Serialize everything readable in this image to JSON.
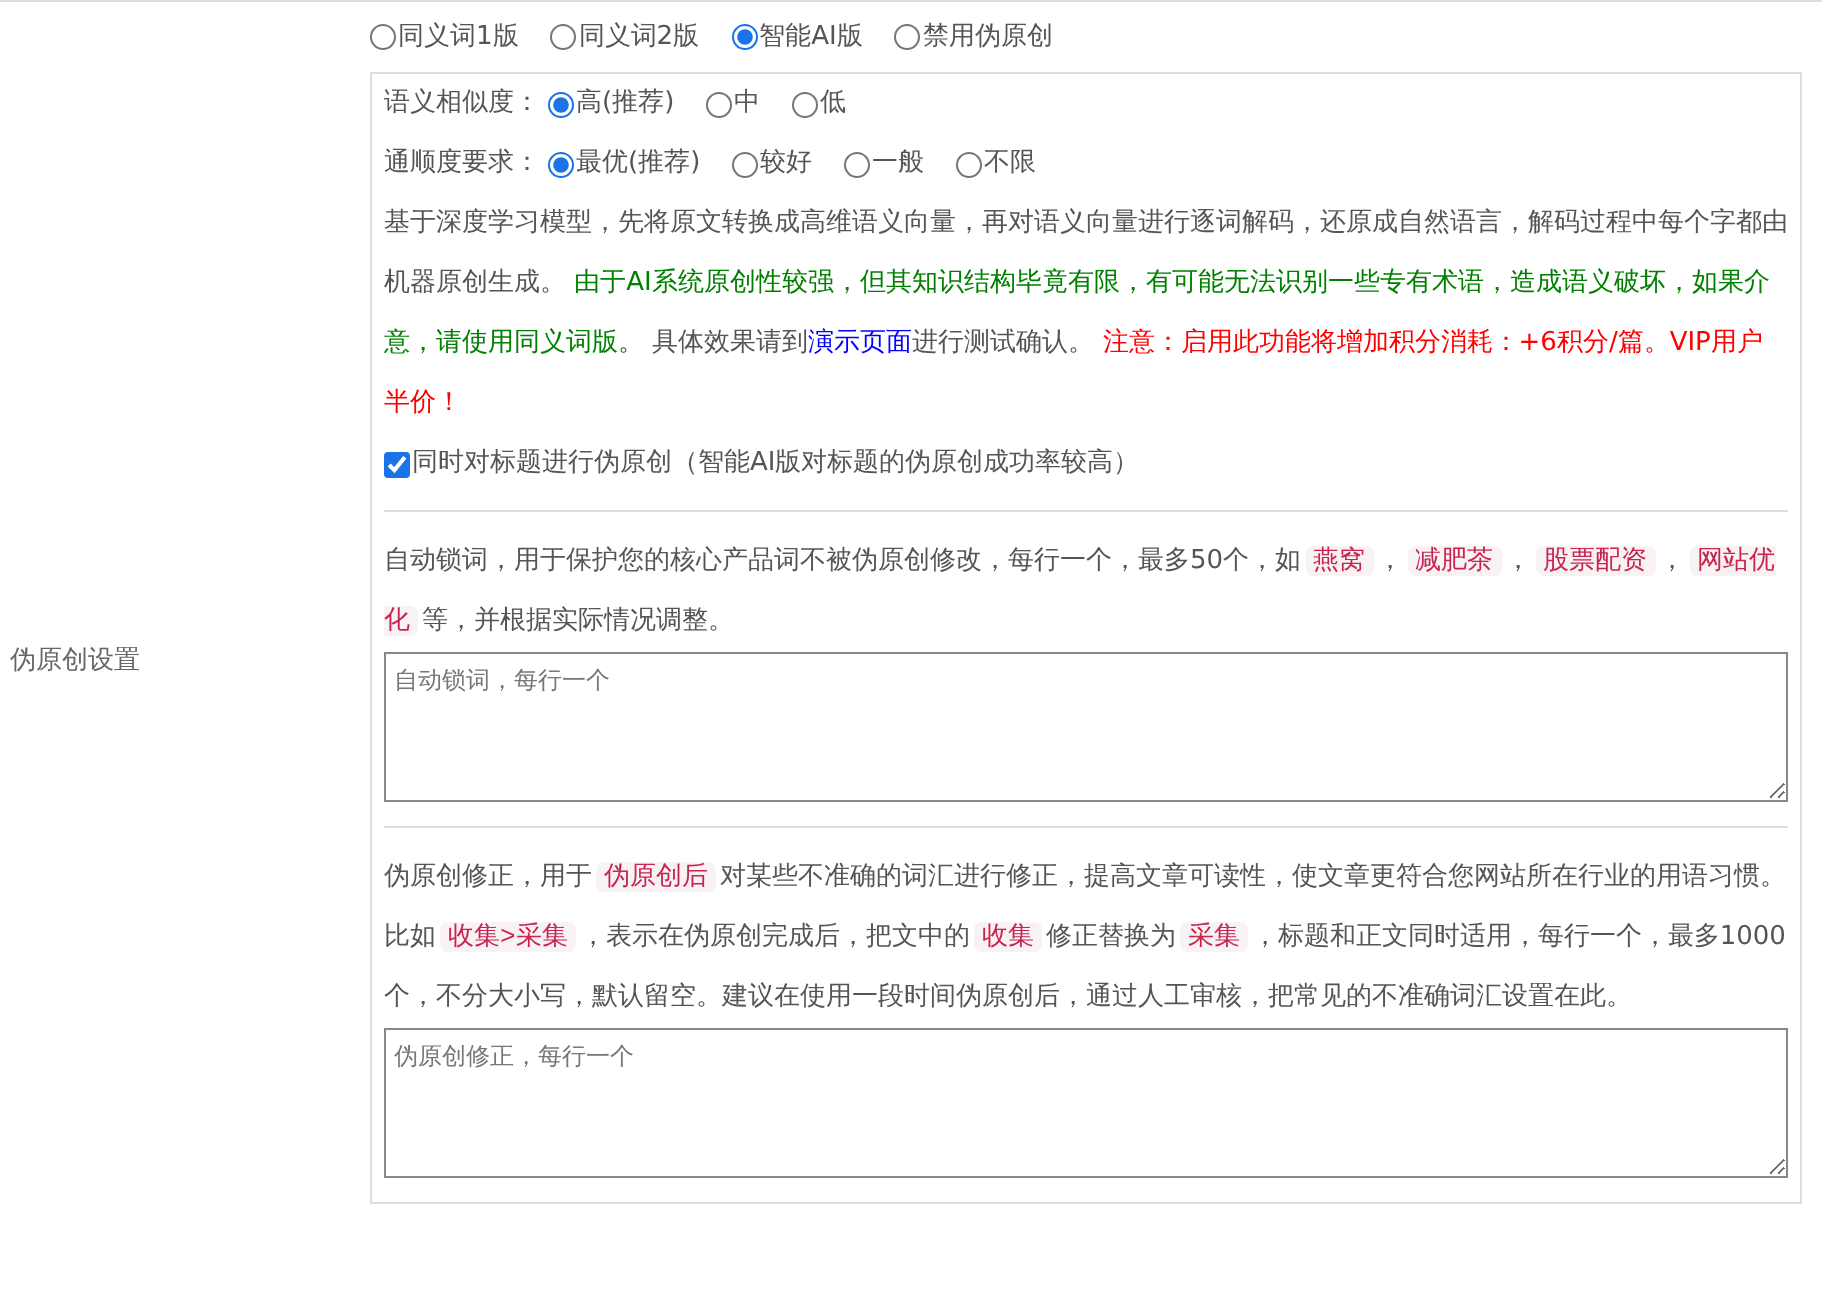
{
  "side_label": "伪原创设置",
  "modes": [
    {
      "label": "同义词1版",
      "selected": false
    },
    {
      "label": "同义词2版",
      "selected": false
    },
    {
      "label": "智能AI版",
      "selected": true
    },
    {
      "label": "禁用伪原创",
      "selected": false
    }
  ],
  "option_rows": [
    {
      "label": "语义相似度：",
      "options": [
        {
          "label": "高(推荐)",
          "selected": true
        },
        {
          "label": "中",
          "selected": false
        },
        {
          "label": "低",
          "selected": false
        }
      ]
    },
    {
      "label": "通顺度要求：",
      "options": [
        {
          "label": "最优(推荐)",
          "selected": true
        },
        {
          "label": "较好",
          "selected": false
        },
        {
          "label": "一般",
          "selected": false
        },
        {
          "label": "不限",
          "selected": false
        }
      ]
    }
  ],
  "ai_description": [
    {
      "kind": "plain",
      "text": "基于深度学习模型，先将原文转换成高维语义向量，再对语义向量进行逐词解码，还原成自然语言，解码过程中每个字都由机器原创生成。 "
    },
    {
      "kind": "note",
      "text": "由于AI系统原创性较强，但其知识结构毕竟有限，有可能无法识别一些专有术语，造成语义破坏，如果介意，请使用同义词版。"
    },
    {
      "kind": "plain",
      "text": " 具体效果请到"
    },
    {
      "kind": "link",
      "text": "演示页面"
    },
    {
      "kind": "plain",
      "text": "进行测试确认。 "
    },
    {
      "kind": "warning",
      "text": "注意：启用此功能将增加积分消耗：+6积分/篇。VIP用户半价！"
    }
  ],
  "title_option": {
    "label": "同时对标题进行伪原创（智能AI版对标题的伪原创成功率较高）",
    "checked": true
  },
  "sections": [
    {
      "description": [
        {
          "kind": "plain",
          "text": "自动锁词，用于保护您的核心产品词不被伪原创修改，每行一个，最多50个，如"
        },
        {
          "kind": "tag",
          "text": "燕窝"
        },
        {
          "kind": "plain",
          "text": "，"
        },
        {
          "kind": "tag",
          "text": "减肥茶"
        },
        {
          "kind": "plain",
          "text": "，"
        },
        {
          "kind": "tag",
          "text": "股票配资"
        },
        {
          "kind": "plain",
          "text": "，"
        },
        {
          "kind": "tag",
          "text": "网站优化"
        },
        {
          "kind": "plain",
          "text": "等，并根据实际情况调整。"
        }
      ],
      "placeholder": "自动锁词，每行一个"
    },
    {
      "description": [
        {
          "kind": "plain",
          "text": "伪原创修正，用于"
        },
        {
          "kind": "tag",
          "text": "伪原创后"
        },
        {
          "kind": "plain",
          "text": "对某些不准确的词汇进行修正，提高文章可读性，使文章更符合您网站所在行业的用语习惯。比如"
        },
        {
          "kind": "tag",
          "text": "收集>采集"
        },
        {
          "kind": "plain",
          "text": "，表示在伪原创完成后，把文中的"
        },
        {
          "kind": "tag",
          "text": "收集"
        },
        {
          "kind": "plain",
          "text": "修正替换为"
        },
        {
          "kind": "tag",
          "text": "采集"
        },
        {
          "kind": "plain",
          "text": "，标题和正文同时适用，每行一个，最多1000个，不分大小写，默认留空。建议在使用一段时间伪原创后，通过人工审核，把常见的不准确词汇设置在此。"
        }
      ],
      "placeholder": "伪原创修正，每行一个"
    }
  ]
}
